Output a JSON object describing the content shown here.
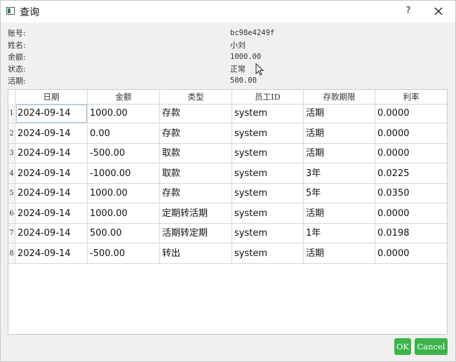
{
  "window": {
    "title": "查询",
    "help_label": "?"
  },
  "info": [
    {
      "label": "账号:",
      "value": "bc98e4249f"
    },
    {
      "label": "姓名:",
      "value": "小刘"
    },
    {
      "label": "余额:",
      "value": "1000.00"
    },
    {
      "label": "状态:",
      "value": "正常"
    },
    {
      "label": "活期:",
      "value": "500.00"
    }
  ],
  "table": {
    "headers": [
      "日期",
      "金额",
      "类型",
      "员工ID",
      "存款期限",
      "利率"
    ],
    "rows": [
      {
        "num": "1",
        "cells": [
          "2024-09-14",
          "1000.00",
          "存款",
          "system",
          "活期",
          "0.0000"
        ]
      },
      {
        "num": "2",
        "cells": [
          "2024-09-14",
          "0.00",
          "存款",
          "system",
          "活期",
          "0.0000"
        ]
      },
      {
        "num": "3",
        "cells": [
          "2024-09-14",
          "-500.00",
          "取款",
          "system",
          "活期",
          "0.0000"
        ]
      },
      {
        "num": "4",
        "cells": [
          "2024-09-14",
          "-1000.00",
          "取款",
          "system",
          "3年",
          "0.0225"
        ]
      },
      {
        "num": "5",
        "cells": [
          "2024-09-14",
          "1000.00",
          "存款",
          "system",
          "5年",
          "0.0350"
        ]
      },
      {
        "num": "6",
        "cells": [
          "2024-09-14",
          "1000.00",
          "定期转活期",
          "system",
          "活期",
          "0.0000"
        ]
      },
      {
        "num": "7",
        "cells": [
          "2024-09-14",
          "500.00",
          "活期转定期",
          "system",
          "1年",
          "0.0198"
        ]
      },
      {
        "num": "8",
        "cells": [
          "2024-09-14",
          "-500.00",
          "转出",
          "system",
          "活期",
          "0.0000"
        ]
      }
    ]
  },
  "buttons": {
    "ok": "OK",
    "cancel": "Cancel"
  },
  "colors": {
    "button_green": "#3cb44b"
  }
}
